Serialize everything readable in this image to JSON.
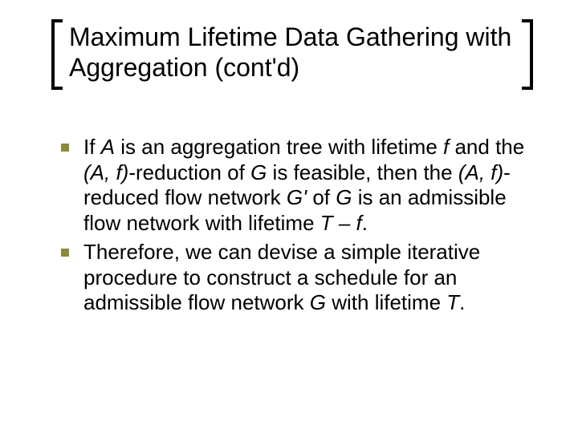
{
  "slide": {
    "title": "Maximum Lifetime Data Gathering with Aggregation (cont'd)",
    "bullets": [
      {
        "runs": [
          {
            "t": "If "
          },
          {
            "t": "A",
            "i": true
          },
          {
            "t": " is an aggregation tree with lifetime "
          },
          {
            "t": "f",
            "i": true
          },
          {
            "t": " and the "
          },
          {
            "t": "(A, f)",
            "i": true
          },
          {
            "t": "-reduction of "
          },
          {
            "t": "G",
            "i": true
          },
          {
            "t": " is feasible, then the "
          },
          {
            "t": "(A, f)",
            "i": true
          },
          {
            "t": "-reduced flow network "
          },
          {
            "t": "G'",
            "i": true
          },
          {
            "t": " of "
          },
          {
            "t": "G",
            "i": true
          },
          {
            "t": " is an admissible flow network with lifetime "
          },
          {
            "t": "T – f",
            "i": true
          },
          {
            "t": "."
          }
        ]
      },
      {
        "runs": [
          {
            "t": "Therefore, we can devise a simple iterative procedure to construct a schedule for an admissible flow network "
          },
          {
            "t": "G",
            "i": true
          },
          {
            "t": " with lifetime "
          },
          {
            "t": "T",
            "i": true
          },
          {
            "t": "."
          }
        ]
      }
    ],
    "colors": {
      "bullet": "#8a8a3a"
    }
  }
}
